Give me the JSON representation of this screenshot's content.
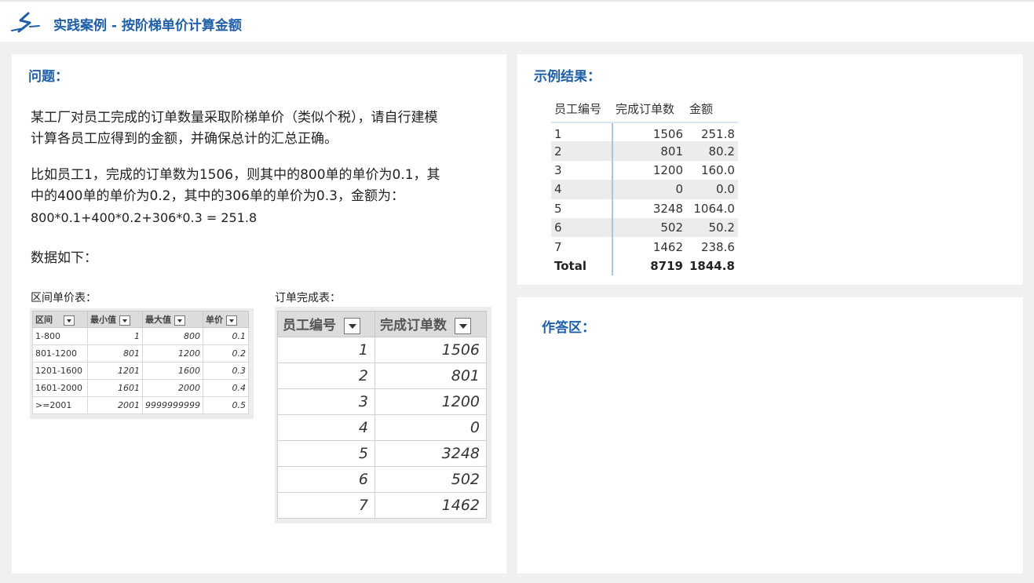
{
  "header": {
    "title": "实践案例 - 按阶梯单价计算金额"
  },
  "question": {
    "title": "问题：",
    "p1_l1": "某工厂对员工完成的订单数量采取阶梯单价（类似个税），请自行建模",
    "p1_l2": "计算各员工应得到的金额，并确保总计的汇总正确。",
    "p2_l1": "比如员工1，完成的订单数为1506，则其中的800单的单价为0.1，其",
    "p2_l2": "中的400单的单价为0.2，其中的306单的单价为0.3，金额为：",
    "p2_l3": "800*0.1+400*0.2+306*0.3 = 251.8",
    "p3": "数据如下：",
    "range_caption": "区间单价表：",
    "orders_caption": "订单完成表："
  },
  "range_table": {
    "headers": [
      "区间",
      "最小值",
      "最大值",
      "单价"
    ],
    "rows": [
      [
        "1-800",
        "1",
        "800",
        "0.1"
      ],
      [
        "801-1200",
        "801",
        "1200",
        "0.2"
      ],
      [
        "1201-1600",
        "1201",
        "1600",
        "0.3"
      ],
      [
        "1601-2000",
        "1601",
        "2000",
        "0.4"
      ],
      [
        ">=2001",
        "2001",
        "9999999999",
        "0.5"
      ]
    ]
  },
  "orders_table": {
    "headers": [
      "员工编号",
      "完成订单数"
    ],
    "rows": [
      [
        "1",
        "1506"
      ],
      [
        "2",
        "801"
      ],
      [
        "3",
        "1200"
      ],
      [
        "4",
        "0"
      ],
      [
        "5",
        "3248"
      ],
      [
        "6",
        "502"
      ],
      [
        "7",
        "1462"
      ]
    ]
  },
  "result": {
    "title": "示例结果：",
    "headers": [
      "员工编号",
      "完成订单数",
      "金额"
    ],
    "rows": [
      [
        "1",
        "1506",
        "251.8"
      ],
      [
        "2",
        "801",
        "80.2"
      ],
      [
        "3",
        "1200",
        "160.0"
      ],
      [
        "4",
        "0",
        "0.0"
      ],
      [
        "5",
        "3248",
        "1064.0"
      ],
      [
        "6",
        "502",
        "50.2"
      ],
      [
        "7",
        "1462",
        "238.6"
      ]
    ],
    "total": [
      "Total",
      "8719",
      "1844.8"
    ]
  },
  "answer": {
    "title": "作答区："
  },
  "colors": {
    "accent": "#1f5fa8",
    "panel": "#ffffff",
    "background": "#f0f0f0"
  }
}
